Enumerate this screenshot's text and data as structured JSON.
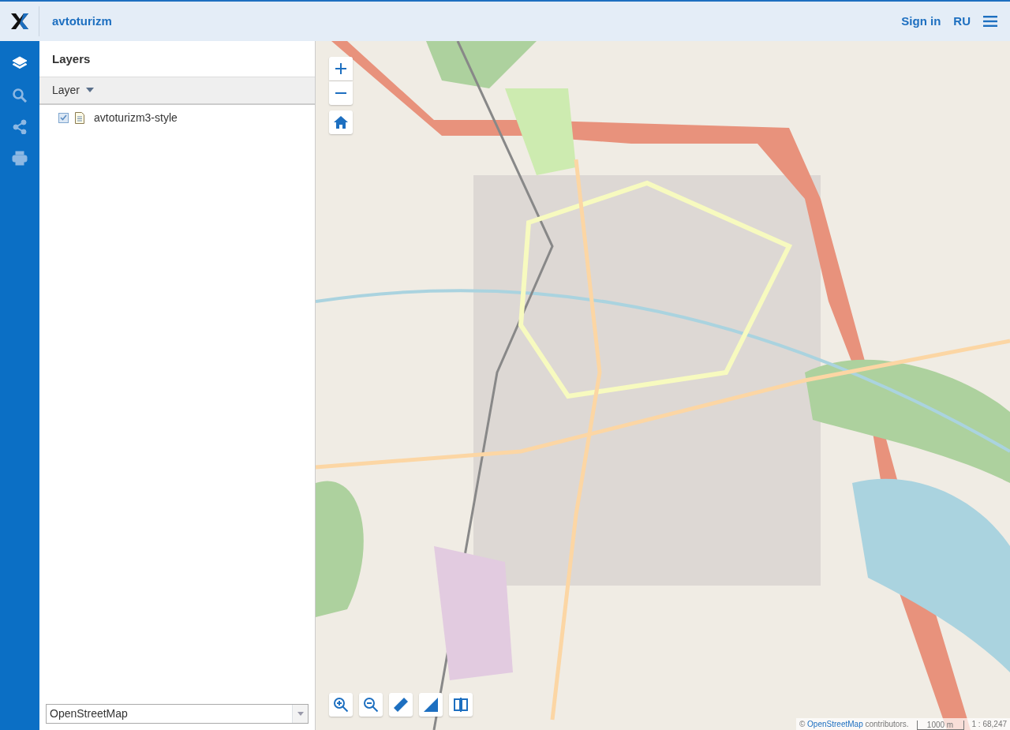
{
  "header": {
    "title": "avtoturizm",
    "sign_in": "Sign in",
    "language": "RU"
  },
  "rail": [
    {
      "kind": "layers",
      "selected": true
    },
    {
      "kind": "search",
      "selected": false
    },
    {
      "kind": "share",
      "selected": false
    },
    {
      "kind": "print",
      "selected": false
    }
  ],
  "panel": {
    "title": "Layers",
    "column": "Layer",
    "layers": [
      {
        "name": "avtoturizm3-style",
        "checked": true
      }
    ],
    "basemap": "OpenStreetMap"
  },
  "map": {
    "tools": [
      {
        "kind": "zoomin"
      },
      {
        "kind": "zoomout"
      },
      {
        "kind": "ruler"
      },
      {
        "kind": "area"
      },
      {
        "kind": "swipe"
      }
    ],
    "attribution_symbol": "©",
    "attribution_link": "OpenStreetMap",
    "attribution_text": "contributors.",
    "scale_bar": "1000 m",
    "scale": "1 : 68,247"
  }
}
